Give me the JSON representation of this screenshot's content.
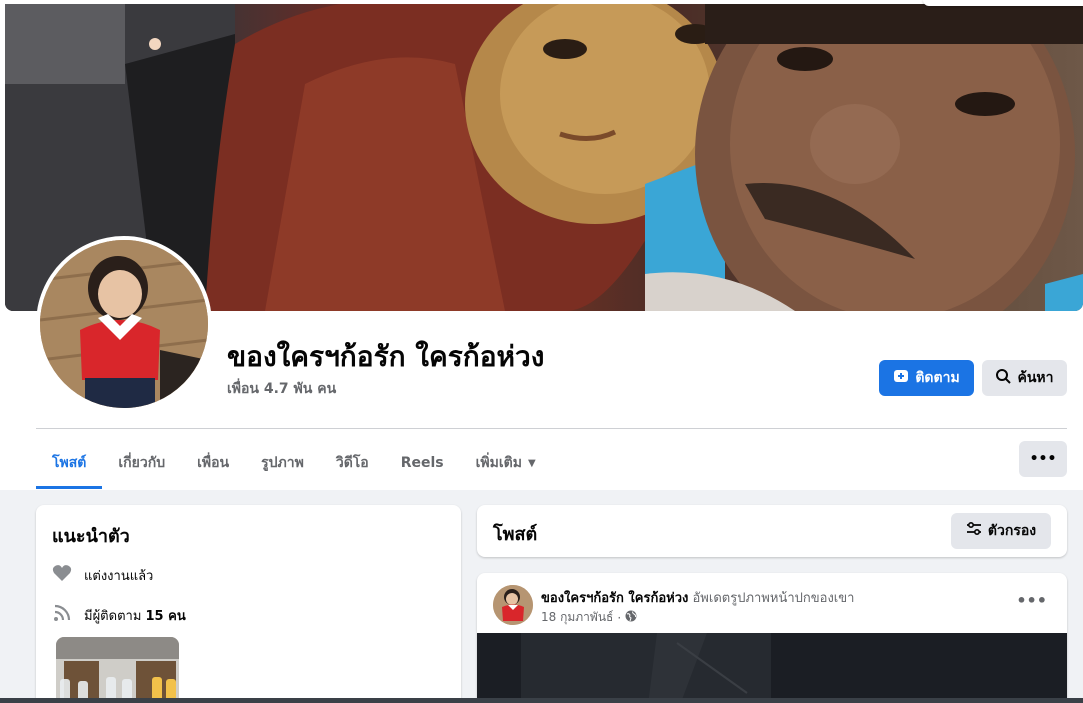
{
  "profile": {
    "name": "ของใครฯก้อรัก ใครก้อห่วง",
    "friends": "เพื่อน 4.7 พัน คน"
  },
  "actions": {
    "follow_label": "ติดตาม",
    "search_label": "ค้นหา",
    "more_label": "•••"
  },
  "tabs": [
    {
      "label": "โพสต์"
    },
    {
      "label": "เกี่ยวกับ"
    },
    {
      "label": "เพื่อน"
    },
    {
      "label": "รูปภาพ"
    },
    {
      "label": "วิดีโอ"
    },
    {
      "label": "Reels"
    },
    {
      "label": "เพิ่มเติม"
    }
  ],
  "intro": {
    "title": "แนะนำตัว",
    "relationship": "แต่งงานแล้ว",
    "followers_prefix": "มีผู้ติดตาม ",
    "followers_count": "15 คน"
  },
  "posts": {
    "title": "โพสต์",
    "filter_label": "ตัวกรอง",
    "first_post": {
      "author": "ของใครฯก้อรัก ใครก้อห่วง",
      "action": "อัพเดตรูปภาพหน้าปกของเขา",
      "date": "18 กุมภาพันธ์",
      "separator": "·",
      "menu_label": "•••"
    }
  },
  "colors": {
    "accent": "#1b74e4",
    "secondary_text": "#65676b",
    "background": "#f0f2f5",
    "button_gray": "#e4e6eb"
  },
  "icons": {
    "follow": "follow-icon",
    "search": "search-icon",
    "caret": "caret-down-icon",
    "heart": "heart-icon",
    "rss": "rss-icon",
    "filter": "filter-icon",
    "globe": "globe-icon"
  }
}
